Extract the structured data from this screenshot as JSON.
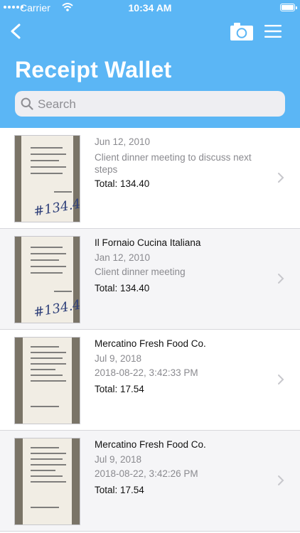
{
  "status_bar": {
    "carrier": "Carrier",
    "time": "10:34 AM"
  },
  "header": {
    "title": "Receipt Wallet"
  },
  "search": {
    "placeholder": "Search"
  },
  "receipts": [
    {
      "merchant": "",
      "date": "Jun 12, 2010",
      "description": "Client dinner meeting to discuss next steps",
      "total": "Total: 134.40"
    },
    {
      "merchant": "Il Fornaio Cucina Italiana",
      "date": "Jan 12, 2010",
      "description": "Client dinner meeting",
      "total": "Total: 134.40"
    },
    {
      "merchant": "Mercatino Fresh Food Co.",
      "date": "Jul 9, 2018",
      "description": "2018-08-22, 3:42:33 PM",
      "total": "Total: 17.54"
    },
    {
      "merchant": "Mercatino Fresh Food Co.",
      "date": "Jul 9, 2018",
      "description": "2018-08-22, 3:42:26 PM",
      "total": "Total: 17.54"
    }
  ],
  "theme": {
    "header_color": "#5bb6f5",
    "list_background": "#ffffff",
    "muted_text": "#8a8a8f"
  },
  "icons": [
    "back-icon",
    "camera-icon",
    "menu-icon",
    "search-icon",
    "chevron-right-icon",
    "wifi-icon",
    "battery-icon"
  ]
}
